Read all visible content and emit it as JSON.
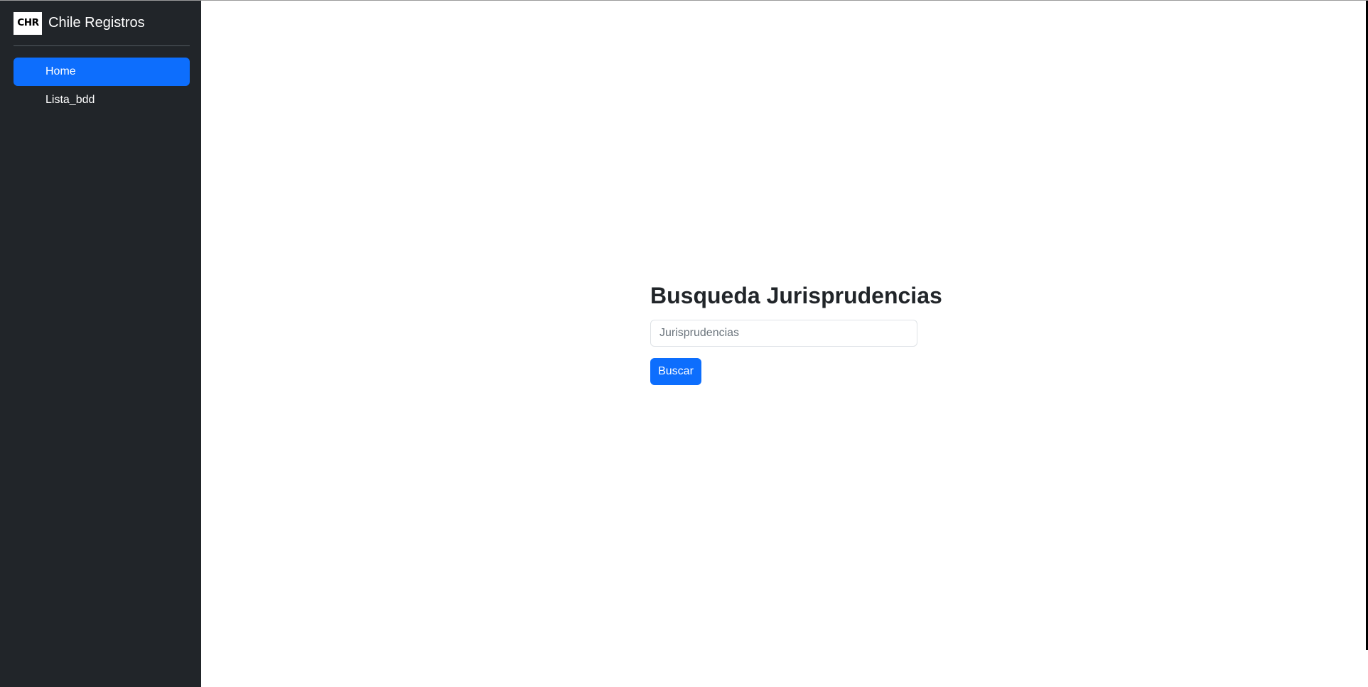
{
  "brand": {
    "logo_text": "CHR",
    "name": "Chile Registros"
  },
  "sidebar": {
    "items": [
      {
        "label": "Home",
        "active": true
      },
      {
        "label": "Lista_bdd",
        "active": false
      }
    ]
  },
  "main": {
    "title": "Busqueda Jurisprudencias",
    "search": {
      "placeholder": "Jurisprudencias",
      "value": ""
    },
    "button_label": "Buscar"
  },
  "colors": {
    "sidebar_bg": "#212529",
    "accent": "#0d6efd",
    "text_dark": "#212529"
  }
}
